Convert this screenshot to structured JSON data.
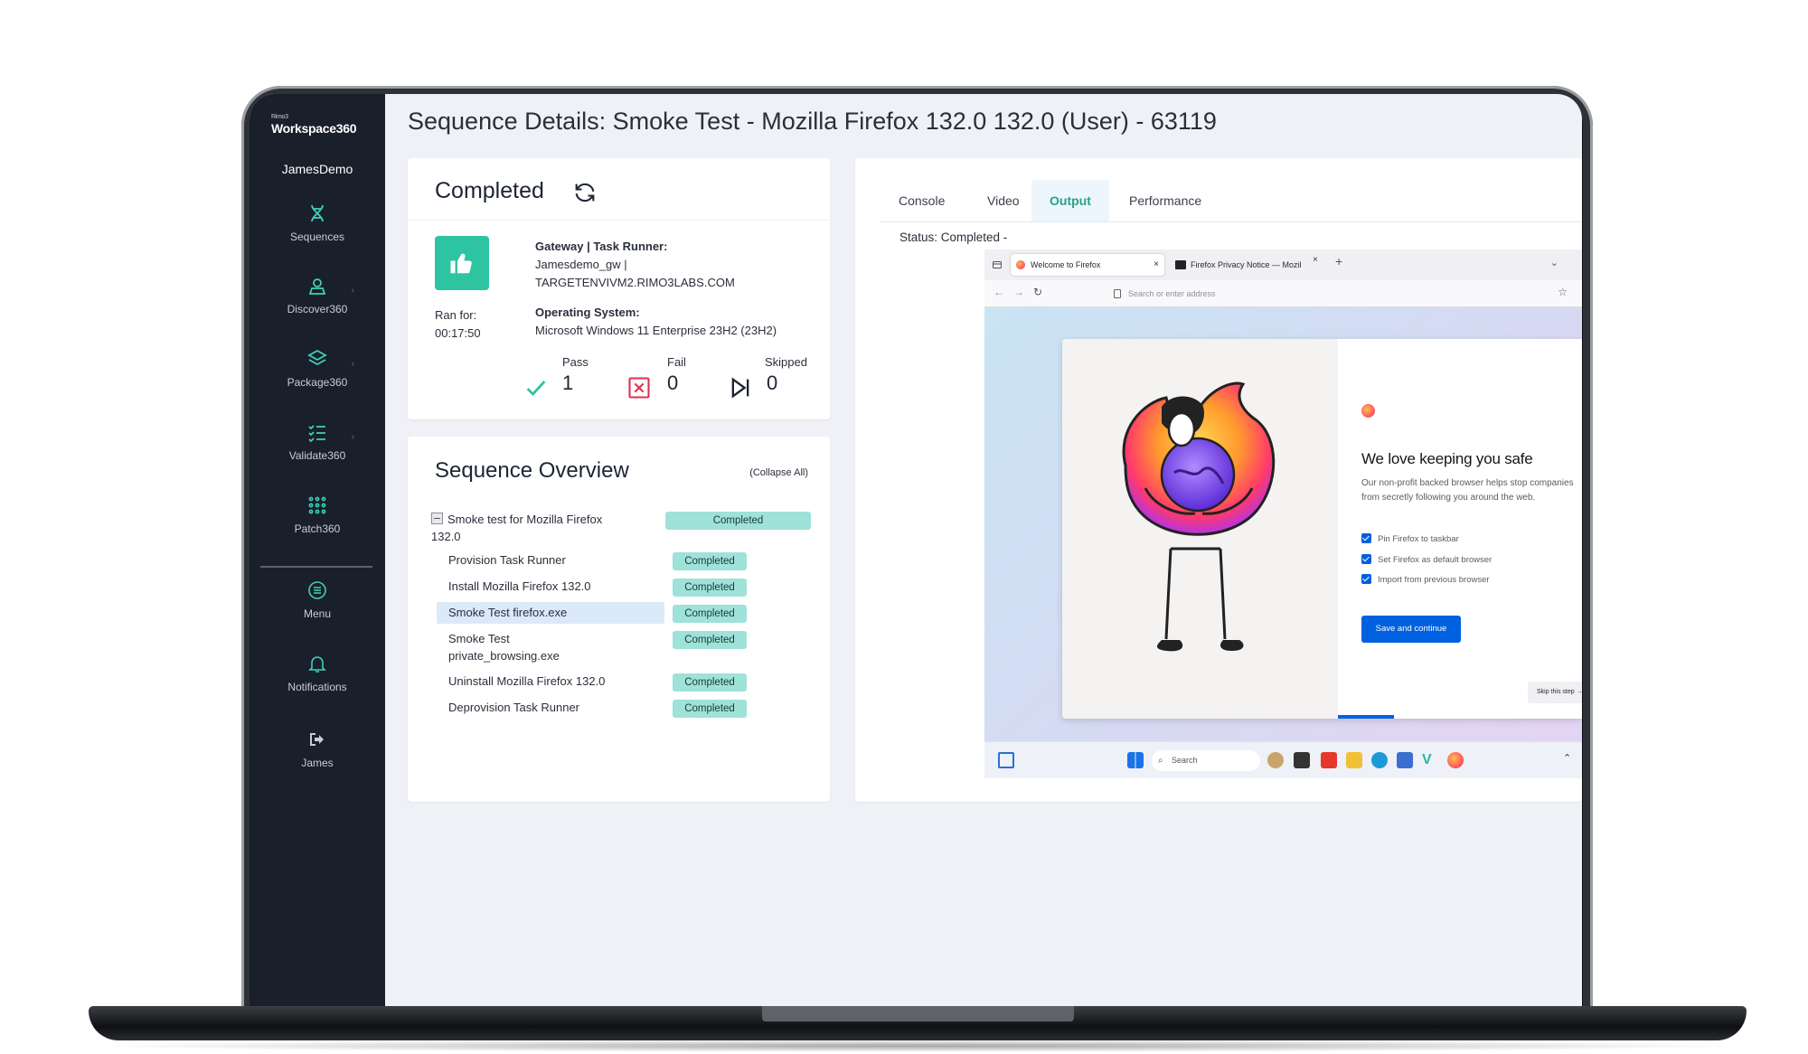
{
  "app": {
    "brand_small": "Rimo3",
    "brand": "Workspace360",
    "user": "JamesDemo"
  },
  "sidebar": {
    "items": [
      {
        "label": "Sequences",
        "icon": "dna-icon"
      },
      {
        "label": "Discover360",
        "icon": "discover-icon"
      },
      {
        "label": "Package360",
        "icon": "layers-icon"
      },
      {
        "label": "Validate360",
        "icon": "checklist-icon"
      },
      {
        "label": "Patch360",
        "icon": "dots-grid-icon"
      },
      {
        "label": "Menu",
        "icon": "menu-icon"
      },
      {
        "label": "Notifications",
        "icon": "bell-icon"
      },
      {
        "label": "James",
        "icon": "sign-out-icon"
      }
    ]
  },
  "page": {
    "title": "Sequence Details: Smoke Test - Mozilla Firefox 132.0 132.0 (User) - 63119"
  },
  "status_card": {
    "status": "Completed",
    "ran_for_label": "Ran for:",
    "ran_for_value": "00:17:50",
    "gateway_label": "Gateway | Task Runner:",
    "gateway_value_1": "Jamesdemo_gw |",
    "gateway_value_2": "TARGETENVIVM2.RIMO3LABS.COM",
    "os_label": "Operating System:",
    "os_value": "Microsoft Windows 11 Enterprise 23H2 (23H2)",
    "pass_label": "Pass",
    "pass_value": "1",
    "fail_label": "Fail",
    "fail_value": "0",
    "skipped_label": "Skipped",
    "skipped_value": "0",
    "accent": "#2ec4a2"
  },
  "overview": {
    "title": "Sequence Overview",
    "collapse_label": "(Collapse All)",
    "root_label_1": "Smoke test for Mozilla Firefox",
    "root_label_2": "132.0",
    "root_status": "Completed",
    "steps": [
      {
        "label": "Provision Task Runner",
        "status": "Completed"
      },
      {
        "label": "Install Mozilla Firefox 132.0",
        "status": "Completed"
      },
      {
        "label": "Smoke Test firefox.exe",
        "status": "Completed"
      },
      {
        "label_1": "Smoke Test",
        "label_2": "private_browsing.exe",
        "status": "Completed"
      },
      {
        "label": "Uninstall Mozilla Firefox 132.0",
        "status": "Completed"
      },
      {
        "label": "Deprovision Task Runner",
        "status": "Completed"
      }
    ],
    "badge_color": "#9ee2d9"
  },
  "output_panel": {
    "tabs": [
      {
        "label": "Console"
      },
      {
        "label": "Video"
      },
      {
        "label": "Output",
        "active": true
      },
      {
        "label": "Performance"
      }
    ],
    "status_text": "Status: Completed -",
    "screenshot": {
      "tab1": "Welcome to Firefox",
      "tab2": "Firefox Privacy Notice — Mozil",
      "address_placeholder": "Search or enter address",
      "heading": "We love keeping you safe",
      "subtext": "Our non-profit backed browser helps stop companies from secretly following you around the web.",
      "checks": [
        "Pin Firefox to taskbar",
        "Set Firefox as default browser",
        "Import from previous browser"
      ],
      "primary_button": "Save and continue",
      "skip_button": "Skip this step →",
      "taskbar_search": "Search"
    }
  }
}
